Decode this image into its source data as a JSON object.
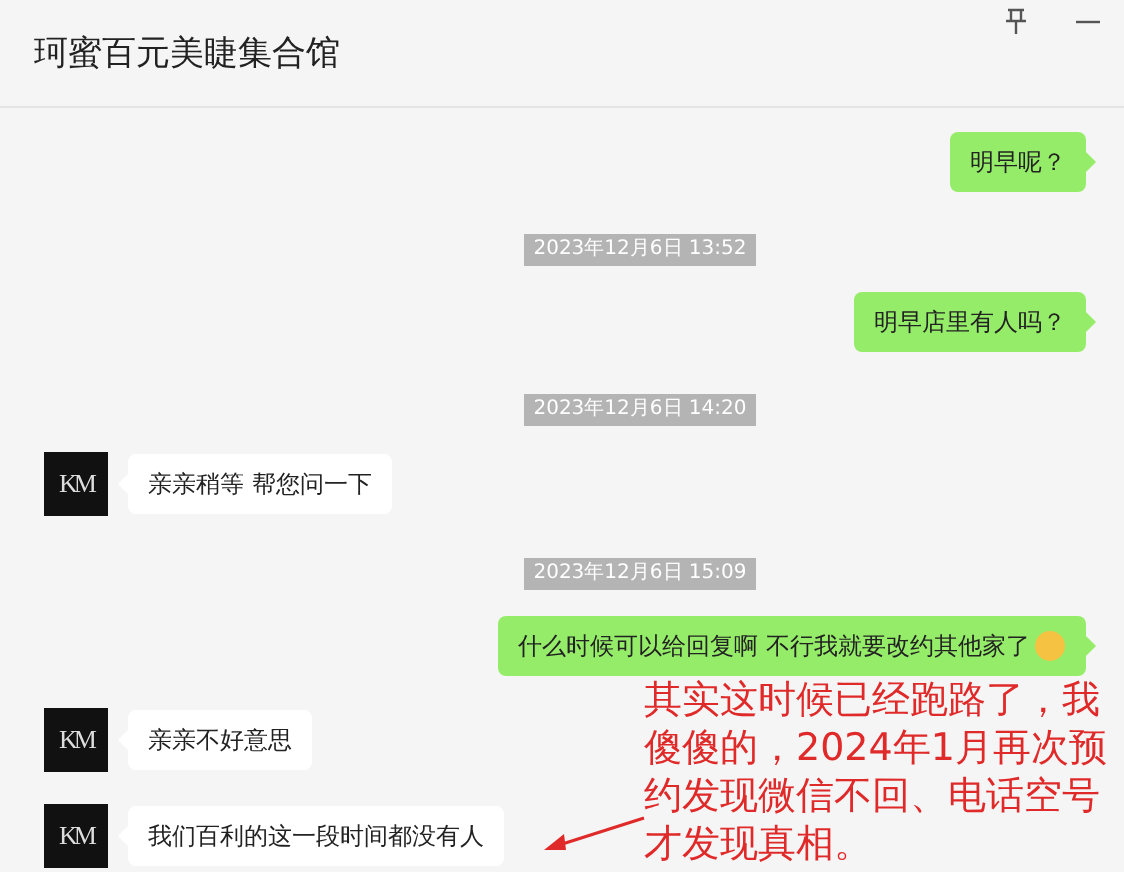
{
  "window": {
    "title": "珂蜜百元美睫集合馆"
  },
  "messages": [
    {
      "kind": "out",
      "text": "明早呢？",
      "emoji": false
    },
    {
      "kind": "time",
      "text": "2023年12月6日 13:52"
    },
    {
      "kind": "out",
      "text": "明早店里有人吗？",
      "emoji": false
    },
    {
      "kind": "time",
      "text": "2023年12月6日 14:20"
    },
    {
      "kind": "in",
      "text": "亲亲稍等 帮您问一下",
      "avatar": "KM"
    },
    {
      "kind": "time",
      "text": "2023年12月6日 15:09"
    },
    {
      "kind": "out",
      "text": "什么时候可以给回复啊 不行我就要改约其他家了",
      "emoji": true
    },
    {
      "kind": "in",
      "text": "亲亲不好意思",
      "avatar": "KM"
    },
    {
      "kind": "in",
      "text": "我们百利的这一段时间都没有人",
      "avatar": "KM"
    }
  ],
  "annotation": {
    "lines": [
      "其实这时候已经跑路了，我",
      "傻傻的，2024年1月再次预",
      "约发现微信不回、电话空号",
      "才发现真相。"
    ]
  }
}
